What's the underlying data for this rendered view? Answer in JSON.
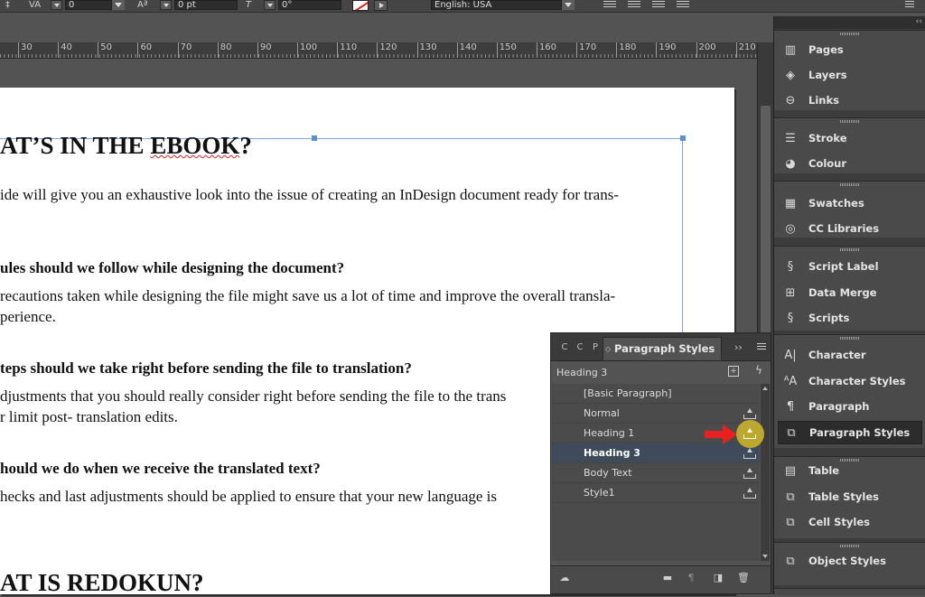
{
  "control_bar": {
    "tracking_value": "0",
    "baseline_value": "0 pt",
    "skew_value": "0°",
    "language": "English: USA"
  },
  "ruler": {
    "ticks": [
      "30",
      "40",
      "50",
      "60",
      "70",
      "80",
      "90",
      "100",
      "110",
      "120",
      "130",
      "140",
      "150",
      "160",
      "170",
      "180",
      "190",
      "200",
      "210"
    ]
  },
  "document": {
    "heading1": "AT’S IN THE ",
    "heading1_spell": "EBOOK",
    "heading1_end": "?",
    "intro": "ide will give you an exhaustive look into the issue of creating an InDesign document ready for trans-",
    "q1": "ules should we follow while designing the document?",
    "q1_line1": "recautions taken while designing the file might save us a lot of time and improve the overall transla-",
    "q1_line2": "perience.",
    "q2": "teps should we take right before sending the file to translation?",
    "q2_line1": "djustments that you should really consider right before sending the file to the trans",
    "q2_line2": "r limit post- translation edits.",
    "q3": "hould we do when we receive the translated text?",
    "q3_line1": "hecks and last adjustments should be applied to ensure that your new language is",
    "heading2": "AT IS REDOKUN?"
  },
  "paragraph_styles_panel": {
    "tab_mini_1": "C",
    "tab_mini_2": "C",
    "tab_mini_3": "P",
    "tab_label": "Paragraph Styles",
    "current_style": "Heading 3",
    "styles": [
      "[Basic Paragraph]",
      "Normal",
      "Heading 1",
      "Heading 3",
      "Body Text",
      "Style1"
    ],
    "selected_style": "Heading 3"
  },
  "dock": {
    "groups": [
      [
        "Pages",
        "Layers",
        "Links"
      ],
      [
        "Stroke",
        "Colour"
      ],
      [
        "Swatches",
        "CC Libraries"
      ],
      [
        "Script Label",
        "Data Merge",
        "Scripts"
      ],
      [
        "Character",
        "Character Styles",
        "Paragraph",
        "Paragraph Styles"
      ],
      [
        "Table",
        "Table Styles",
        "Cell Styles"
      ],
      [
        "Object Styles"
      ]
    ],
    "active_item": "Paragraph Styles"
  },
  "colors": {
    "highlight": "#bda82f",
    "annotation_arrow": "#e82020",
    "selection_frame": "#7fa8e0"
  }
}
